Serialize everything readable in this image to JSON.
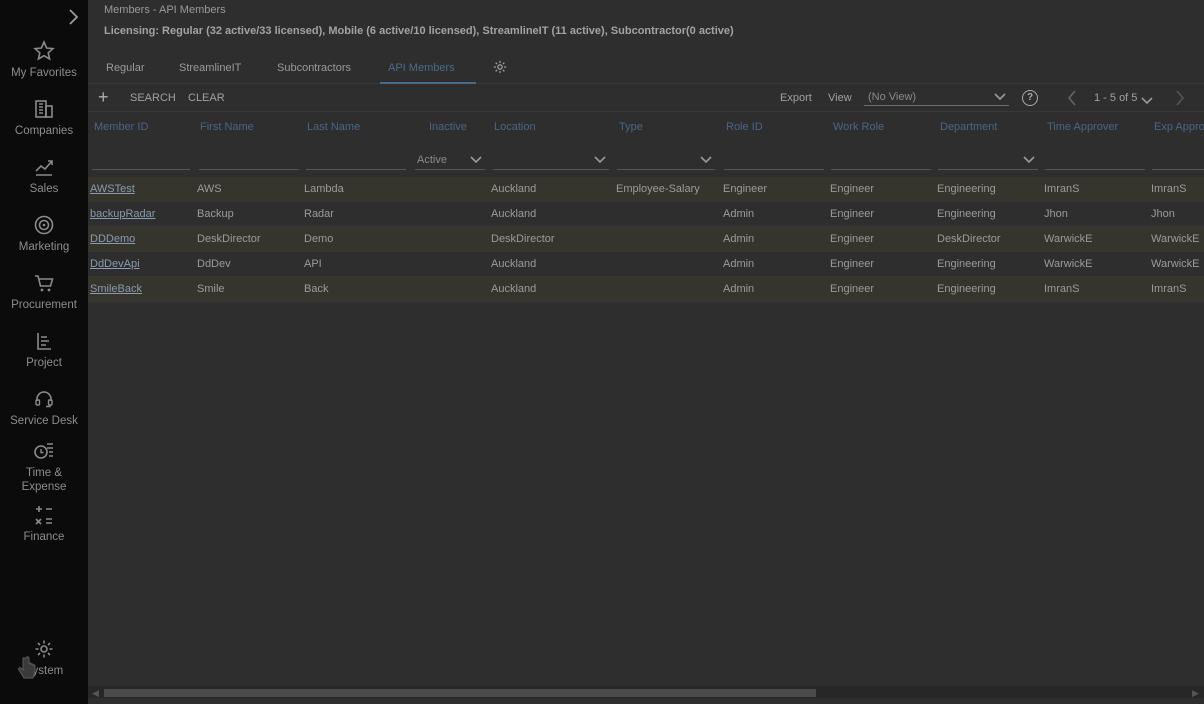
{
  "sidebar": {
    "items": [
      {
        "label": "My Favorites",
        "icon": "star-icon"
      },
      {
        "label": "Companies",
        "icon": "building-icon"
      },
      {
        "label": "Sales",
        "icon": "chart-up-icon"
      },
      {
        "label": "Marketing",
        "icon": "target-icon"
      },
      {
        "label": "Procurement",
        "icon": "cart-icon"
      },
      {
        "label": "Project",
        "icon": "clipboard-icon"
      },
      {
        "label": "Service Desk",
        "icon": "headset-icon"
      },
      {
        "label": "Time &",
        "label2": "Expense",
        "icon": "time-expense-icon"
      },
      {
        "label": "Finance",
        "icon": "calculator-icon"
      },
      {
        "label": "System",
        "icon": "gear-icon"
      }
    ]
  },
  "header": {
    "breadcrumb": "Members - API Members",
    "licensing": "Licensing: Regular (32 active/33 licensed), Mobile (6 active/10 licensed), StreamlineIT (11 active), Subcontractor(0 active)"
  },
  "tabs": [
    "Regular",
    "StreamlineIT",
    "Subcontractors",
    "API Members"
  ],
  "toolbar": {
    "add": "+",
    "search": "SEARCH",
    "clear": "CLEAR",
    "export": "Export",
    "view": "View",
    "view_value": "(No View)",
    "help": "?",
    "paging": "1 - 5 of 5"
  },
  "columns": [
    "Member ID",
    "First Name",
    "Last Name",
    "Inactive",
    "Location",
    "Type",
    "Role ID",
    "Work Role",
    "Department",
    "Time Approver",
    "Exp Appro"
  ],
  "filters": {
    "inactive": "Active"
  },
  "rows": [
    [
      "AWSTest",
      "AWS",
      "Lambda",
      "",
      "Auckland",
      "Employee-Salary",
      "Engineer",
      "Engineer",
      "Engineering",
      "ImranS",
      "ImranS"
    ],
    [
      "backupRadar",
      "Backup",
      "Radar",
      "",
      "Auckland",
      "",
      "Admin",
      "Engineer",
      "Engineering",
      "Jhon",
      "Jhon"
    ],
    [
      "DDDemo",
      "DeskDirector",
      "Demo",
      "",
      "DeskDirector",
      "",
      "Admin",
      "Engineer",
      "DeskDirector",
      "WarwickE",
      "WarwickE"
    ],
    [
      "DdDevApi",
      "DdDev",
      "API",
      "",
      "Auckland",
      "",
      "Admin",
      "Engineer",
      "Engineering",
      "WarwickE",
      "WarwickE"
    ],
    [
      "SmileBack",
      "Smile",
      "Back",
      "",
      "Auckland",
      "",
      "Admin",
      "Engineer",
      "Engineering",
      "ImranS",
      "ImranS"
    ]
  ],
  "colors": {
    "accent": "#4a6a8a",
    "sidebar_bg": "#0b0b0b",
    "main_bg": "#2e2e2e"
  }
}
